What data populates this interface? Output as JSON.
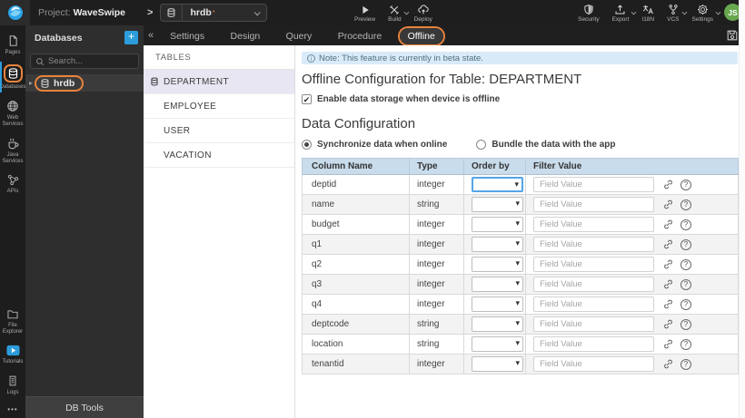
{
  "colors": {
    "accent_blue": "#2d9cdb",
    "annotation_orange": "#e8833c",
    "table_header_bg": "#c9dcec",
    "note_bg": "#d9eaf8",
    "selected_table_bg": "#e8e6f2",
    "avatar_green": "#67a74f"
  },
  "topbar": {
    "project_prefix": "Project:",
    "project_name": "WaveSwipe",
    "db_selector_value": "hrdb",
    "actions_left": [
      {
        "label": "Preview",
        "icon": "play-icon",
        "caret": false
      },
      {
        "label": "Build",
        "icon": "build-icon",
        "caret": true
      },
      {
        "label": "Deploy",
        "icon": "deploy-icon",
        "caret": false
      }
    ],
    "actions_right": [
      {
        "label": "Security",
        "icon": "shield-icon",
        "caret": false
      },
      {
        "label": "Export",
        "icon": "export-icon",
        "caret": true
      },
      {
        "label": "I18N",
        "icon": "translate-icon",
        "caret": false
      },
      {
        "label": "VCS",
        "icon": "branch-icon",
        "caret": true
      },
      {
        "label": "Settings",
        "icon": "gear-icon",
        "caret": true
      }
    ],
    "avatar_initials": "JS"
  },
  "sidebar": {
    "top_items": [
      {
        "label": "Pages",
        "icon": "page-icon",
        "active": false,
        "annotated": false
      },
      {
        "label": "Databases",
        "icon": "database-icon",
        "active": true,
        "annotated": true
      },
      {
        "label": "Web Services",
        "icon": "globe-icon",
        "active": false,
        "annotated": false
      },
      {
        "label": "Java Services",
        "icon": "coffee-icon",
        "active": false,
        "annotated": false
      },
      {
        "label": "APIs",
        "icon": "api-icon",
        "active": false,
        "annotated": false
      }
    ],
    "bottom_items": [
      {
        "label": "File Explorer",
        "icon": "folder-icon",
        "active": false,
        "annotated": false
      },
      {
        "label": "Tutorials",
        "icon": "tutorials-icon",
        "active": false,
        "annotated": false
      },
      {
        "label": "Logs",
        "icon": "logs-icon",
        "active": false,
        "annotated": false
      }
    ],
    "more_label": "•••"
  },
  "db_panel": {
    "title": "Databases",
    "add_label": "+",
    "search_placeholder": "Search...",
    "tree_item": "hrdb",
    "footer_label": "DB Tools"
  },
  "editor": {
    "collapse_glyph": "«",
    "tabs": [
      "Settings",
      "Design",
      "Query",
      "Procedure",
      "Offline"
    ],
    "active_tab": "Offline"
  },
  "tables_panel": {
    "header": "TABLES",
    "selected": "DEPARTMENT",
    "items": [
      "DEPARTMENT",
      "EMPLOYEE",
      "USER",
      "VACATION"
    ]
  },
  "main": {
    "note_text": "Note: This feature is currently in beta state.",
    "page_title": "Offline Configuration for Table: DEPARTMENT",
    "enable_checkbox_label": "Enable data storage when device is offline",
    "enable_checked": true,
    "section_title": "Data Configuration",
    "radio_options": [
      {
        "label": "Synchronize data when online",
        "selected": true
      },
      {
        "label": "Bundle the data with the app",
        "selected": false
      }
    ],
    "columns_table": {
      "headers": [
        "Column Name",
        "Type",
        "Order by",
        "Filter Value"
      ],
      "filter_placeholder": "Field Value",
      "order_by_value": "",
      "rows": [
        {
          "column_name": "deptid",
          "type": "integer",
          "focused": true
        },
        {
          "column_name": "name",
          "type": "string",
          "focused": false
        },
        {
          "column_name": "budget",
          "type": "integer",
          "focused": false
        },
        {
          "column_name": "q1",
          "type": "integer",
          "focused": false
        },
        {
          "column_name": "q2",
          "type": "integer",
          "focused": false
        },
        {
          "column_name": "q3",
          "type": "integer",
          "focused": false
        },
        {
          "column_name": "q4",
          "type": "integer",
          "focused": false
        },
        {
          "column_name": "deptcode",
          "type": "string",
          "focused": false
        },
        {
          "column_name": "location",
          "type": "string",
          "focused": false
        },
        {
          "column_name": "tenantid",
          "type": "integer",
          "focused": false
        }
      ]
    }
  }
}
